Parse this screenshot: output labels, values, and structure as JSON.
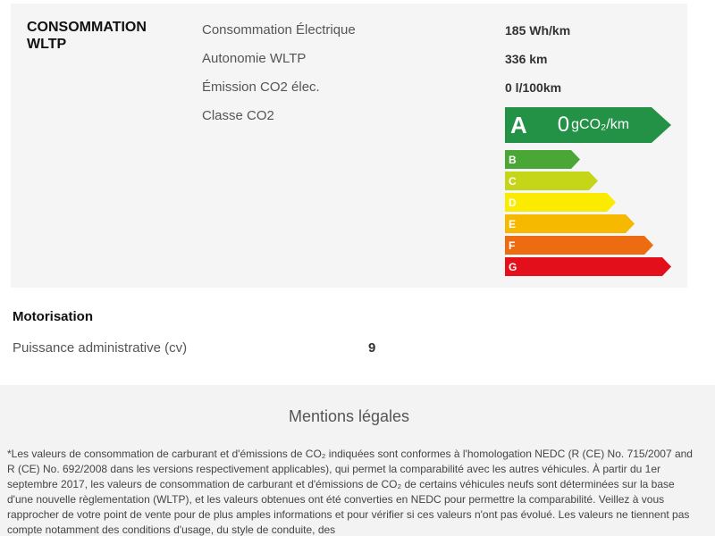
{
  "conso": {
    "title": "CONSOMMATION WLTP",
    "rows": [
      {
        "label": "Consommation Électrique",
        "value": "185 Wh/km"
      },
      {
        "label": "Autonomie WLTP",
        "value": "336 km"
      },
      {
        "label": "Émission CO2 élec.",
        "value": "0 l/100km"
      },
      {
        "label": "Classe CO2",
        "value": ""
      }
    ],
    "energy_label": {
      "active_class": "A",
      "active_value": "0",
      "active_unit": "gCO₂/km",
      "classes": [
        {
          "letter": "B",
          "color": "#4aa635"
        },
        {
          "letter": "C",
          "color": "#c5d618"
        },
        {
          "letter": "D",
          "color": "#fbeb00"
        },
        {
          "letter": "E",
          "color": "#f7b800"
        },
        {
          "letter": "F",
          "color": "#ed6c12"
        },
        {
          "letter": "G",
          "color": "#e3101b"
        }
      ],
      "a_color": "#239146"
    }
  },
  "motorisation": {
    "title": "Motorisation",
    "label": "Puissance administrative (cv)",
    "value": "9"
  },
  "legal": {
    "title": "Mentions légales",
    "text": "*Les valeurs de consommation de carburant et d'émissions de CO₂ indiquées sont conformes à l'homologation NEDC (R (CE) No. 715/2007 and R (CE) No. 692/2008 dans les versions respectivement applicables), qui permet la comparabilité avec les autres véhicules. À partir du 1er septembre 2017, les valeurs de consommation de carburant et d'émissions de CO₂ de certains véhicules neufs sont déterminées sur la base d'une nouvelle règlementation (WLTP), et les valeurs obtenues ont été converties en NEDC pour permettre la comparabilité. Veillez à vous rapprocher de votre point de vente pour de plus amples informations et pour vérifier si ces valeurs n'ont pas évolué. Les valeurs ne tiennent pas compte notamment des conditions d'usage, du style de conduite, des"
  }
}
